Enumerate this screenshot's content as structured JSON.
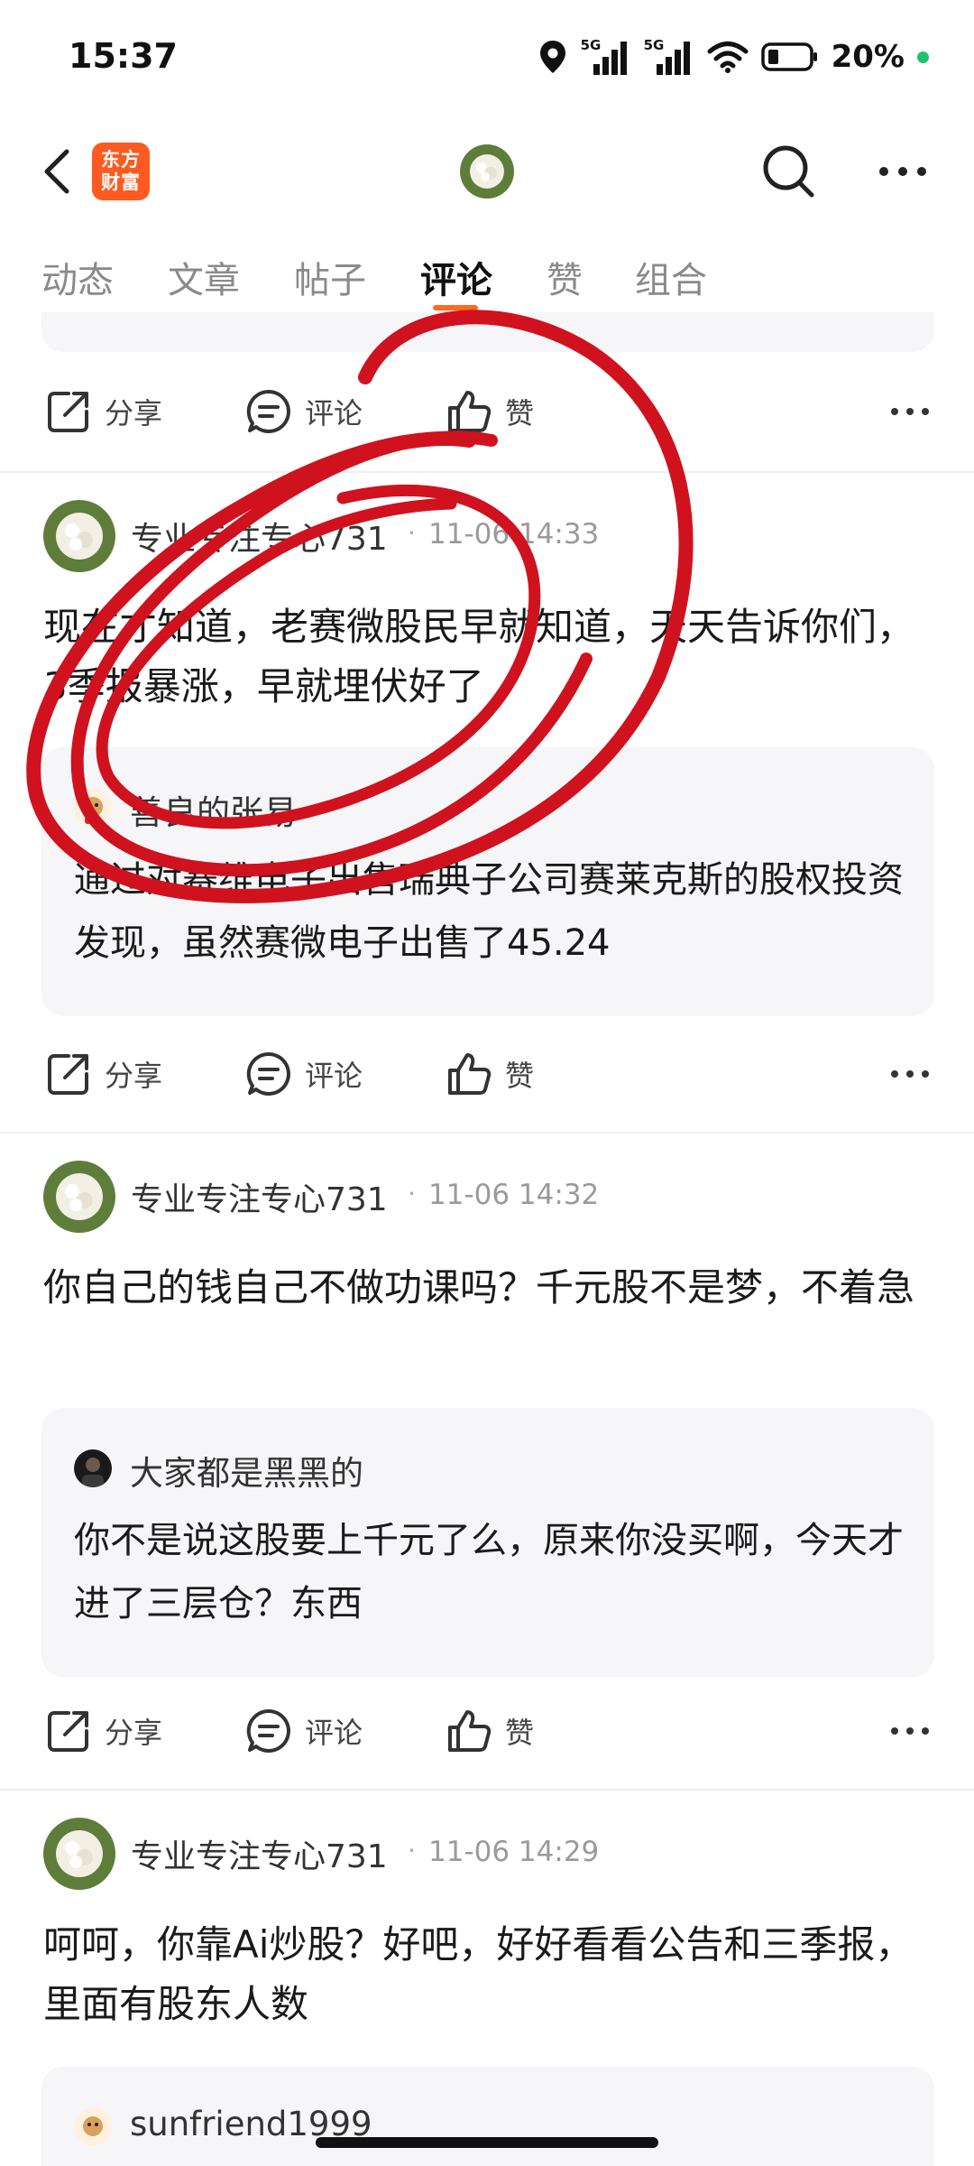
{
  "status_bar": {
    "time": "15:37",
    "signal1_tag": "5G",
    "signal2_tag": "5G",
    "battery_pct": "20%",
    "icons": [
      "location-icon",
      "signal-icon",
      "signal-icon",
      "wifi-icon",
      "battery-icon"
    ]
  },
  "header": {
    "logo_line1": "东方",
    "logo_line2": "财富",
    "brand_color": "#ff5a1f"
  },
  "tabs": [
    {
      "label": "动态"
    },
    {
      "label": "文章"
    },
    {
      "label": "帖子"
    },
    {
      "label": "评论",
      "active": true
    },
    {
      "label": "赞"
    },
    {
      "label": "组合"
    }
  ],
  "actions": {
    "share": "分享",
    "comment": "评论",
    "like": "赞"
  },
  "posts": [
    {
      "author": "专业专注专心731",
      "sep": "·",
      "time": "11-06 14:33",
      "text": "现在才知道，老赛微股民早就知道，天天告诉你们，3季报暴涨，早就埋伏好了",
      "quote": {
        "author": "善良的张易",
        "text": "通过对赛维电子出售瑞典子公司赛莱克斯的股权投资发现，虽然赛微电子出售了45.24"
      }
    },
    {
      "author": "专业专注专心731",
      "sep": "·",
      "time": "11-06 14:32",
      "text": "你自己的钱自己不做功课吗？千元股不是梦，不着急",
      "quote": {
        "author": "大家都是黑黑的",
        "text": "你不是说这股要上千元了么，原来你没买啊，今天才进了三层仓？东西"
      }
    },
    {
      "author": "专业专注专心731",
      "sep": "·",
      "time": "11-06 14:29",
      "text": "呵呵，你靠Ai炒股？好吧，好好看看公告和三季报，里面有股东人数",
      "quote": {
        "author": "sunfriend1999",
        "text": ""
      }
    }
  ],
  "annotation_color": "#d0121e"
}
